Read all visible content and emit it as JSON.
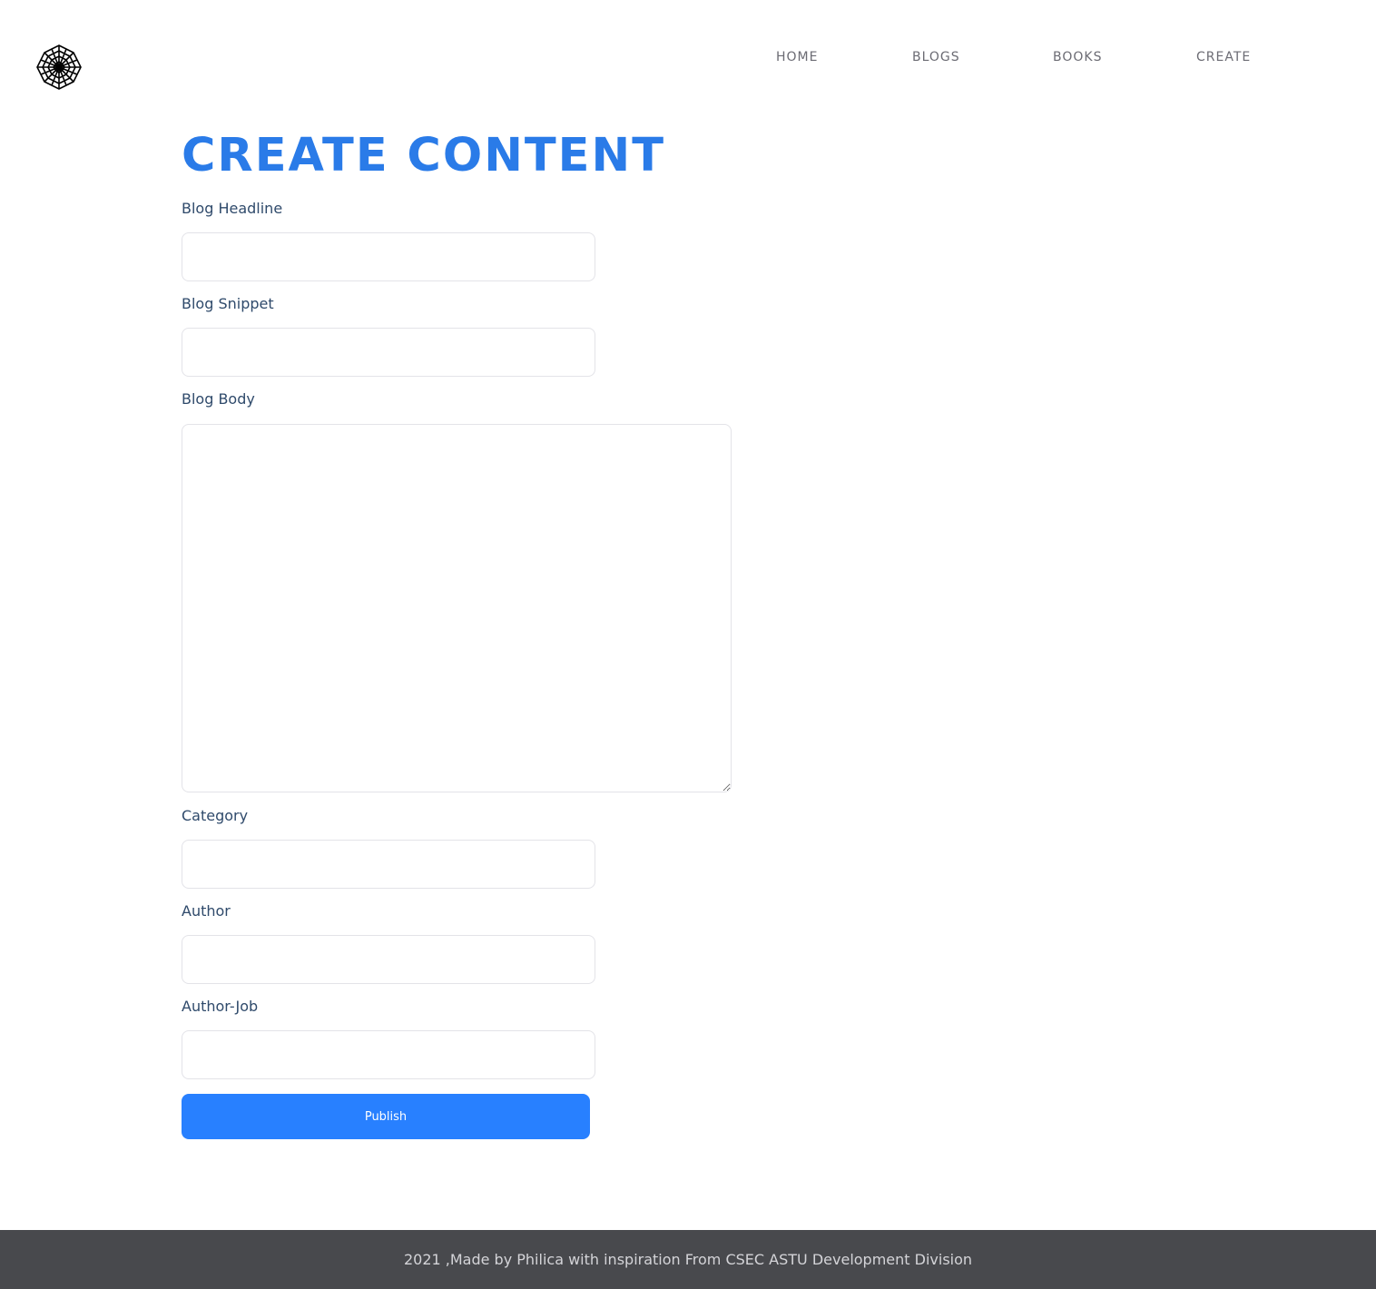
{
  "logo": {
    "icon": "spider-web-icon"
  },
  "nav": {
    "items": [
      {
        "label": "HOME"
      },
      {
        "label": "BLOGS"
      },
      {
        "label": "BOOKS"
      },
      {
        "label": "CREATE"
      }
    ]
  },
  "page": {
    "title": "CREATE CONTENT"
  },
  "form": {
    "headline_label": "Blog Headline",
    "snippet_label": "Blog Snippet",
    "body_label": "Blog Body",
    "category_label": "Category",
    "author_label": "Author",
    "author_job_label": "Author-Job",
    "headline_value": "",
    "snippet_value": "",
    "body_value": "",
    "category_value": "",
    "author_value": "",
    "author_job_value": "",
    "publish_label": "Publish"
  },
  "footer": {
    "text": "2021 ,Made by Philica with inspiration From CSEC ASTU Development Division"
  },
  "colors": {
    "accent": "#2a7be8",
    "button": "#2880ff",
    "footer_bg": "#48494d",
    "label": "#2f4a6b"
  }
}
